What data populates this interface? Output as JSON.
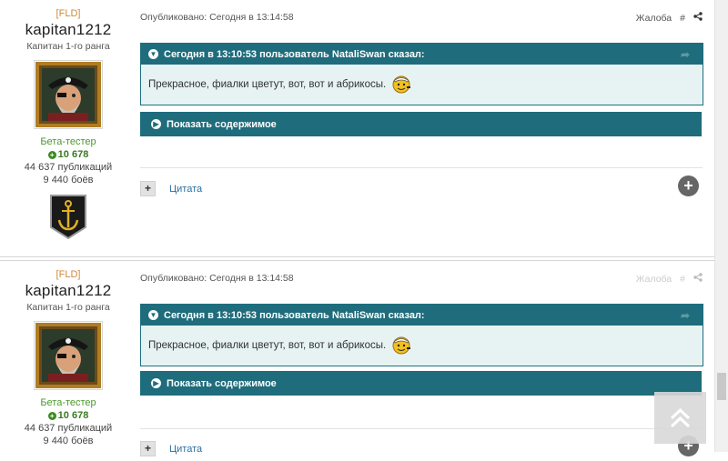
{
  "posts": [
    {
      "clan": "[FLD]",
      "username": "kapitan1212",
      "rank": "Капитан 1-го ранга",
      "group": "Бета-тестер",
      "reputation": "10 678",
      "publications": "44 637 публикаций",
      "battles": "9 440 боёв",
      "published": "Опубликовано: Сегодня в 13:14:58",
      "report": "Жалоба",
      "hash": "#",
      "quote_header": "Сегодня в 13:10:53 пользователь NataliSwan сказал:",
      "quote_text": "Прекрасное, фиалки цветут, вот, вот и абрикосы.",
      "spoiler_label": "Показать содержимое",
      "cite_label": "Цитата"
    },
    {
      "clan": "[FLD]",
      "username": "kapitan1212",
      "rank": "Капитан 1-го ранга",
      "group": "Бета-тестер",
      "reputation": "10 678",
      "publications": "44 637 публикаций",
      "battles": "9 440 боёв",
      "published": "Опубликовано: Сегодня в 13:14:58",
      "report": "Жалоба",
      "hash": "#",
      "quote_header": "Сегодня в 13:10:53 пользователь NataliSwan сказал:",
      "quote_text": "Прекрасное, фиалки цветут, вот, вот и абрикосы.",
      "spoiler_label": "Показать содержимое",
      "cite_label": "Цитата"
    }
  ],
  "colors": {
    "accent": "#1e6c7c",
    "quote_bg": "#e6f3f2",
    "clan": "#d08a3a",
    "group": "#4a9a2a",
    "link": "#2a6fa0"
  },
  "icons": {
    "share": "share-icon",
    "reputation": "plus-circle-icon",
    "expand": "chevron-down-icon",
    "spoiler": "chevron-right-icon",
    "scroll_top": "double-chevron-up-icon",
    "smiley": "sailor-smiley-icon",
    "badge": "anchor-badge-icon",
    "quote_share": "share-arrow-icon"
  }
}
